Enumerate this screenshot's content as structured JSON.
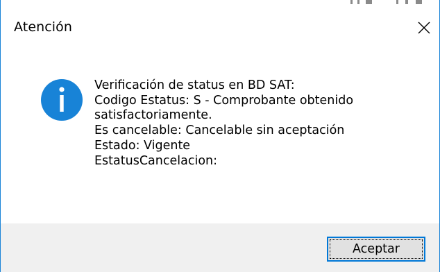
{
  "dialog": {
    "title": "Atención",
    "close_icon": "close-icon",
    "info_icon": "info-icon",
    "accent_color": "#1883d7",
    "message_lines": [
      "Verificación de status en BD SAT:",
      "Codigo Estatus: S - Comprobante obtenido",
      "satisfactoriamente.",
      "Es cancelable: Cancelable sin aceptación",
      "Estado: Vigente",
      "EstatusCancelacion:"
    ],
    "ok_label": "Aceptar"
  }
}
